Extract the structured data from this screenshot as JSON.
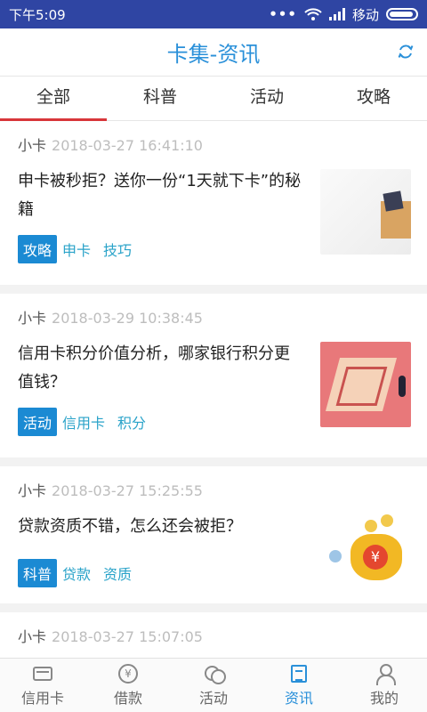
{
  "status_bar": {
    "time": "下午5:09",
    "dots": "•••",
    "carrier": "移动"
  },
  "header": {
    "title": "卡集-资讯",
    "refresh_icon": "refresh-icon"
  },
  "tabs": [
    {
      "label": "全部",
      "active": true
    },
    {
      "label": "科普",
      "active": false
    },
    {
      "label": "活动",
      "active": false
    },
    {
      "label": "攻略",
      "active": false
    }
  ],
  "articles": [
    {
      "author": "小卡",
      "date": "2018-03-27 16:41:10",
      "title": "申卡被秒拒？送你一份“1天就下卡”的秘籍",
      "category": "攻略",
      "keywords": [
        "申卡",
        "技巧"
      ]
    },
    {
      "author": "小卡",
      "date": "2018-03-29 10:38:45",
      "title": "信用卡积分价值分析，哪家银行积分更值钱？",
      "category": "活动",
      "keywords": [
        "信用卡",
        "积分"
      ]
    },
    {
      "author": "小卡",
      "date": "2018-03-27 15:25:55",
      "title": "贷款资质不错，怎么还会被拒？",
      "category": "科普",
      "keywords": [
        "贷款",
        "资质"
      ]
    },
    {
      "author": "小卡",
      "date": "2018-03-27 15:07:05"
    }
  ],
  "thumb_glyphs": {
    "yen": "¥"
  },
  "bottom_nav": [
    {
      "label": "信用卡",
      "icon": "credit-card-icon",
      "active": false
    },
    {
      "label": "借款",
      "icon": "loan-coin-icon",
      "active": false
    },
    {
      "label": "活动",
      "icon": "activity-chat-icon",
      "active": false
    },
    {
      "label": "资讯",
      "icon": "news-icon",
      "active": true
    },
    {
      "label": "我的",
      "icon": "user-icon",
      "active": false
    }
  ],
  "colors": {
    "status_bar": "#2f45a3",
    "accent": "#2a90d9",
    "tab_indicator": "#d8363a",
    "category_tag": "#1b8ad3",
    "keyword": "#2aa3c9"
  }
}
